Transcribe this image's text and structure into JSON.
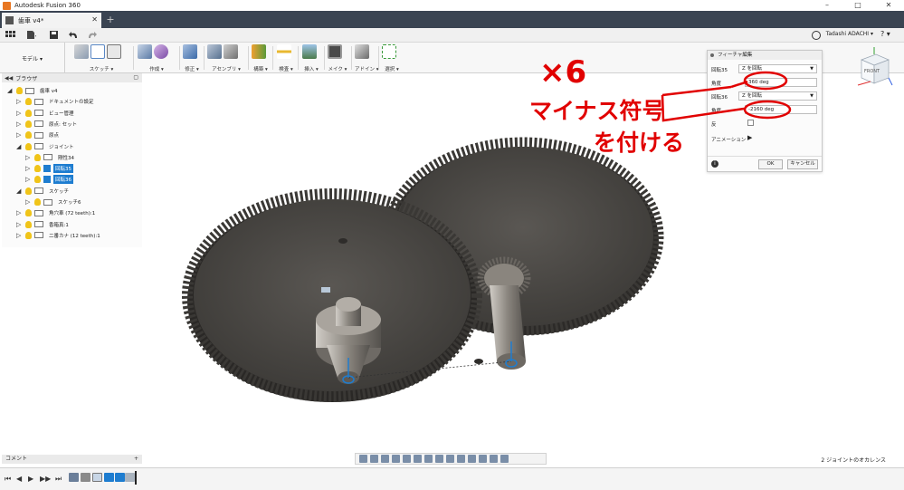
{
  "window": {
    "title": "Autodesk Fusion 360",
    "min": "–",
    "max": "□",
    "close": "✕"
  },
  "tab": {
    "label": "歯車 v4*",
    "close": "✕",
    "add": "+"
  },
  "quickbar": {
    "user": "Tadashi ADACHI ▾",
    "help": "? ▾"
  },
  "ribbon": {
    "workspace": "モデル ▾",
    "groups": [
      "スケッチ ▾",
      "作成 ▾",
      "修正 ▾",
      "アセンブリ ▾",
      "構築 ▾",
      "検査 ▾",
      "挿入 ▾",
      "メイク ▾",
      "アドイン ▾",
      "選択 ▾"
    ]
  },
  "browser": {
    "title": "ブラウザ",
    "items": [
      {
        "label": "歯車 v4",
        "depth": 0,
        "expanded": true,
        "selected": false
      },
      {
        "label": "ドキュメントの設定",
        "depth": 1,
        "expanded": false,
        "selected": false
      },
      {
        "label": "ビュー管理",
        "depth": 1,
        "expanded": false,
        "selected": false
      },
      {
        "label": "原点: セット",
        "depth": 1,
        "expanded": false,
        "selected": false
      },
      {
        "label": "原点",
        "depth": 1,
        "expanded": false,
        "selected": false
      },
      {
        "label": "ジョイント",
        "depth": 1,
        "expanded": true,
        "selected": false
      },
      {
        "label": "剛性34",
        "depth": 2,
        "expanded": false,
        "selected": false
      },
      {
        "label": "回転35",
        "depth": 2,
        "expanded": false,
        "selected": true
      },
      {
        "label": "回転36",
        "depth": 2,
        "expanded": false,
        "selected": true
      },
      {
        "label": "スケッチ",
        "depth": 1,
        "expanded": true,
        "selected": false
      },
      {
        "label": "スケッチ6",
        "depth": 2,
        "expanded": false,
        "selected": false
      },
      {
        "label": "角穴車 (72 teeth):1",
        "depth": 1,
        "expanded": false,
        "selected": false
      },
      {
        "label": "香箱真:1",
        "depth": 1,
        "expanded": false,
        "selected": false
      },
      {
        "label": "二番カナ (12 teeth):1",
        "depth": 1,
        "expanded": false,
        "selected": false
      }
    ]
  },
  "comments": {
    "label": "コメント",
    "plus": "+"
  },
  "dialog": {
    "title": "フィーチャ編集",
    "joint1_label": "回転35",
    "joint1_type": "Z を回転",
    "angle1_label": "角度",
    "angle1_value": "360 deg",
    "joint2_label": "回転36",
    "joint2_type": "Z を回転",
    "angle2_label": "角度",
    "angle2_value": "-2160 deg",
    "reverse_label": "反",
    "animation_label": "アニメーション",
    "animation_play": "▶",
    "ok": "OK",
    "cancel": "キャンセル",
    "info": "i"
  },
  "annotation": {
    "line1": "×6",
    "line2": "マイナス符号",
    "line3": "を付ける"
  },
  "viewcube": {
    "face": "FRONT"
  },
  "status": {
    "text": "2 ジョイントのオカレンス"
  },
  "timeline": {
    "first": "⏮",
    "prev": "◀",
    "play": "▶",
    "next": "▶▶",
    "last": "⏭"
  },
  "colors": {
    "selection_blue": "#1e7dd0",
    "annotation_red": "#e10000",
    "tabbar": "#3a4452",
    "gear_metal": "#4a4744"
  }
}
